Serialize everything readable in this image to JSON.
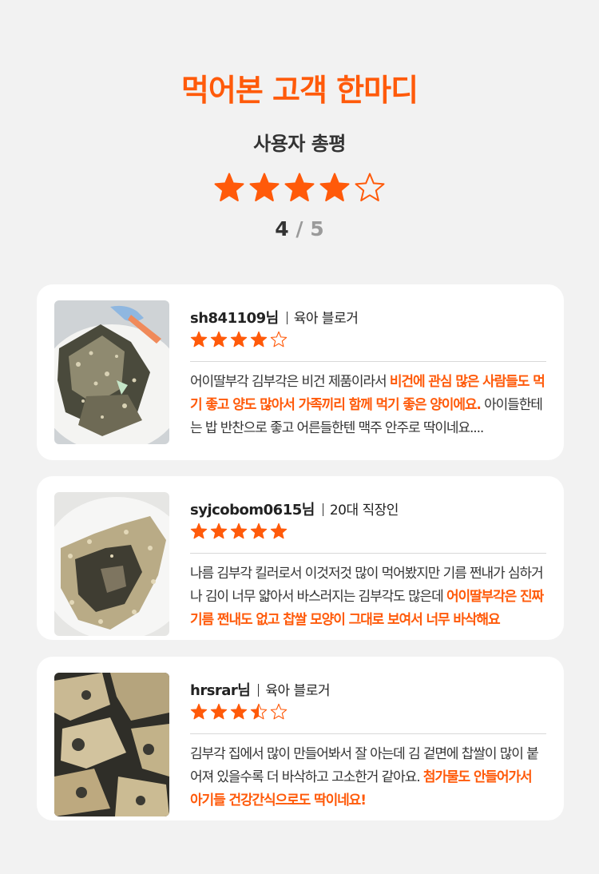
{
  "header": {
    "title": "먹어본 고객 한마디",
    "subtitle": "사용자 총평",
    "rating": 4,
    "score_current": "4",
    "score_sep": "/",
    "score_max": "5"
  },
  "colors": {
    "accent": "#ff5a0a",
    "card_bg": "#ffffff",
    "page_bg": "#f2f2f2"
  },
  "reviews": [
    {
      "username": "sh841109님",
      "role": "육아 블로거",
      "rating": 4,
      "text_plain": "어이딸부각 김부각은 비건 제품이라서 ",
      "text_highlight": "비건에 관심 많은 사람들도 먹기 좋고 양도 많아서 가족끼리 함께 먹기 좋은 양이에요.",
      "text_tail": " 아이들한테는 밥 반찬으로 좋고 어른들한텐 맥주 안주로 딱이네요...."
    },
    {
      "username": "syjcobom0615님",
      "role": "20대 직장인",
      "rating": 5,
      "text_plain": "나름 김부각 킬러로서 이것저것 많이 먹어봤지만 기름 쩐내가 심하거나 김이 너무 얇아서 바스러지는 김부각도 많은데 ",
      "text_highlight": "어이딸부각은 진짜 기름 쩐내도 없고 찹쌀 모양이 그대로 보여서 너무 바삭해요",
      "text_tail": ""
    },
    {
      "username": "hrsrar님",
      "role": "육아 블로거",
      "rating": 3.5,
      "text_plain": "김부각 집에서 많이 만들어봐서 잘 아는데 김 겉면에 찹쌀이 많이 붙어져 있을수록 더 바삭하고 고소한거 같아요. ",
      "text_highlight": "첨가물도 안들어가서 아기들 건강간식으로도 딱이네요!",
      "text_tail": ""
    }
  ]
}
